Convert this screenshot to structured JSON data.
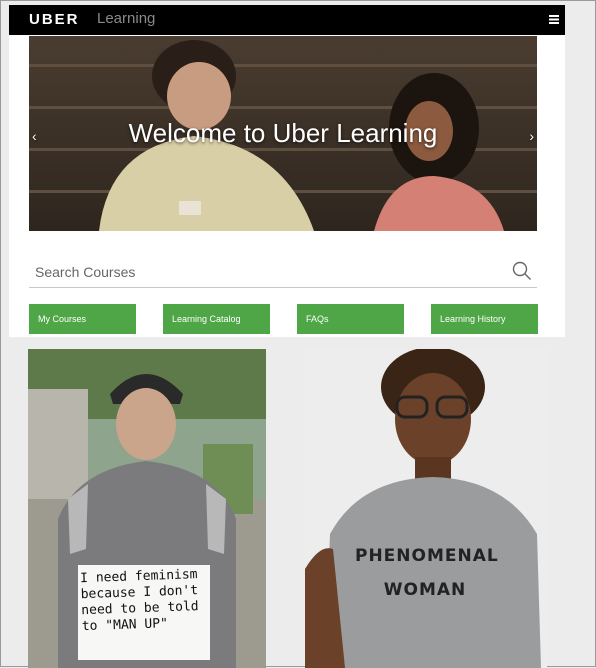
{
  "header": {
    "brand_strong": "UBER",
    "brand_light": "Learning",
    "menu_icon": "hamburger-menu-icon"
  },
  "hero": {
    "title": "Welcome to Uber Learning",
    "prev_icon": "chevron-left-icon",
    "next_icon": "chevron-right-icon",
    "slide_indicator_icon": "dot-icon"
  },
  "search": {
    "placeholder": "Search Courses",
    "icon": "search-icon"
  },
  "nav": {
    "my_courses": "My Courses",
    "learning_catalog": "Learning Catalog",
    "faqs": "FAQs",
    "learning_history": "Learning History"
  },
  "photos": {
    "sign_text": "I need feminism because I don't need to be told to \"MAN UP\"",
    "shirt_line1": "PHENOMENAL",
    "shirt_line2": "WOMAN"
  },
  "colors": {
    "nav_green": "#4fa646",
    "topbar": "#000000"
  }
}
